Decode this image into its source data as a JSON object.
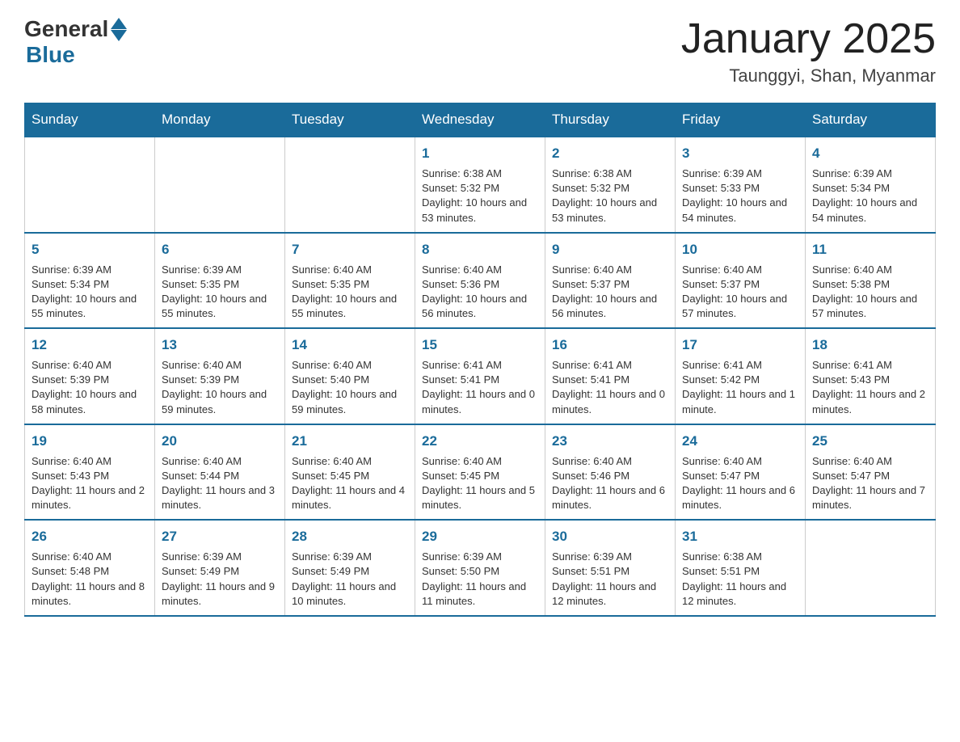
{
  "header": {
    "logo_general": "General",
    "logo_blue": "Blue",
    "title": "January 2025",
    "subtitle": "Taunggyi, Shan, Myanmar"
  },
  "days_of_week": [
    "Sunday",
    "Monday",
    "Tuesday",
    "Wednesday",
    "Thursday",
    "Friday",
    "Saturday"
  ],
  "weeks": [
    [
      {
        "day": "",
        "info": ""
      },
      {
        "day": "",
        "info": ""
      },
      {
        "day": "",
        "info": ""
      },
      {
        "day": "1",
        "info": "Sunrise: 6:38 AM\nSunset: 5:32 PM\nDaylight: 10 hours and 53 minutes."
      },
      {
        "day": "2",
        "info": "Sunrise: 6:38 AM\nSunset: 5:32 PM\nDaylight: 10 hours and 53 minutes."
      },
      {
        "day": "3",
        "info": "Sunrise: 6:39 AM\nSunset: 5:33 PM\nDaylight: 10 hours and 54 minutes."
      },
      {
        "day": "4",
        "info": "Sunrise: 6:39 AM\nSunset: 5:34 PM\nDaylight: 10 hours and 54 minutes."
      }
    ],
    [
      {
        "day": "5",
        "info": "Sunrise: 6:39 AM\nSunset: 5:34 PM\nDaylight: 10 hours and 55 minutes."
      },
      {
        "day": "6",
        "info": "Sunrise: 6:39 AM\nSunset: 5:35 PM\nDaylight: 10 hours and 55 minutes."
      },
      {
        "day": "7",
        "info": "Sunrise: 6:40 AM\nSunset: 5:35 PM\nDaylight: 10 hours and 55 minutes."
      },
      {
        "day": "8",
        "info": "Sunrise: 6:40 AM\nSunset: 5:36 PM\nDaylight: 10 hours and 56 minutes."
      },
      {
        "day": "9",
        "info": "Sunrise: 6:40 AM\nSunset: 5:37 PM\nDaylight: 10 hours and 56 minutes."
      },
      {
        "day": "10",
        "info": "Sunrise: 6:40 AM\nSunset: 5:37 PM\nDaylight: 10 hours and 57 minutes."
      },
      {
        "day": "11",
        "info": "Sunrise: 6:40 AM\nSunset: 5:38 PM\nDaylight: 10 hours and 57 minutes."
      }
    ],
    [
      {
        "day": "12",
        "info": "Sunrise: 6:40 AM\nSunset: 5:39 PM\nDaylight: 10 hours and 58 minutes."
      },
      {
        "day": "13",
        "info": "Sunrise: 6:40 AM\nSunset: 5:39 PM\nDaylight: 10 hours and 59 minutes."
      },
      {
        "day": "14",
        "info": "Sunrise: 6:40 AM\nSunset: 5:40 PM\nDaylight: 10 hours and 59 minutes."
      },
      {
        "day": "15",
        "info": "Sunrise: 6:41 AM\nSunset: 5:41 PM\nDaylight: 11 hours and 0 minutes."
      },
      {
        "day": "16",
        "info": "Sunrise: 6:41 AM\nSunset: 5:41 PM\nDaylight: 11 hours and 0 minutes."
      },
      {
        "day": "17",
        "info": "Sunrise: 6:41 AM\nSunset: 5:42 PM\nDaylight: 11 hours and 1 minute."
      },
      {
        "day": "18",
        "info": "Sunrise: 6:41 AM\nSunset: 5:43 PM\nDaylight: 11 hours and 2 minutes."
      }
    ],
    [
      {
        "day": "19",
        "info": "Sunrise: 6:40 AM\nSunset: 5:43 PM\nDaylight: 11 hours and 2 minutes."
      },
      {
        "day": "20",
        "info": "Sunrise: 6:40 AM\nSunset: 5:44 PM\nDaylight: 11 hours and 3 minutes."
      },
      {
        "day": "21",
        "info": "Sunrise: 6:40 AM\nSunset: 5:45 PM\nDaylight: 11 hours and 4 minutes."
      },
      {
        "day": "22",
        "info": "Sunrise: 6:40 AM\nSunset: 5:45 PM\nDaylight: 11 hours and 5 minutes."
      },
      {
        "day": "23",
        "info": "Sunrise: 6:40 AM\nSunset: 5:46 PM\nDaylight: 11 hours and 6 minutes."
      },
      {
        "day": "24",
        "info": "Sunrise: 6:40 AM\nSunset: 5:47 PM\nDaylight: 11 hours and 6 minutes."
      },
      {
        "day": "25",
        "info": "Sunrise: 6:40 AM\nSunset: 5:47 PM\nDaylight: 11 hours and 7 minutes."
      }
    ],
    [
      {
        "day": "26",
        "info": "Sunrise: 6:40 AM\nSunset: 5:48 PM\nDaylight: 11 hours and 8 minutes."
      },
      {
        "day": "27",
        "info": "Sunrise: 6:39 AM\nSunset: 5:49 PM\nDaylight: 11 hours and 9 minutes."
      },
      {
        "day": "28",
        "info": "Sunrise: 6:39 AM\nSunset: 5:49 PM\nDaylight: 11 hours and 10 minutes."
      },
      {
        "day": "29",
        "info": "Sunrise: 6:39 AM\nSunset: 5:50 PM\nDaylight: 11 hours and 11 minutes."
      },
      {
        "day": "30",
        "info": "Sunrise: 6:39 AM\nSunset: 5:51 PM\nDaylight: 11 hours and 12 minutes."
      },
      {
        "day": "31",
        "info": "Sunrise: 6:38 AM\nSunset: 5:51 PM\nDaylight: 11 hours and 12 minutes."
      },
      {
        "day": "",
        "info": ""
      }
    ]
  ]
}
